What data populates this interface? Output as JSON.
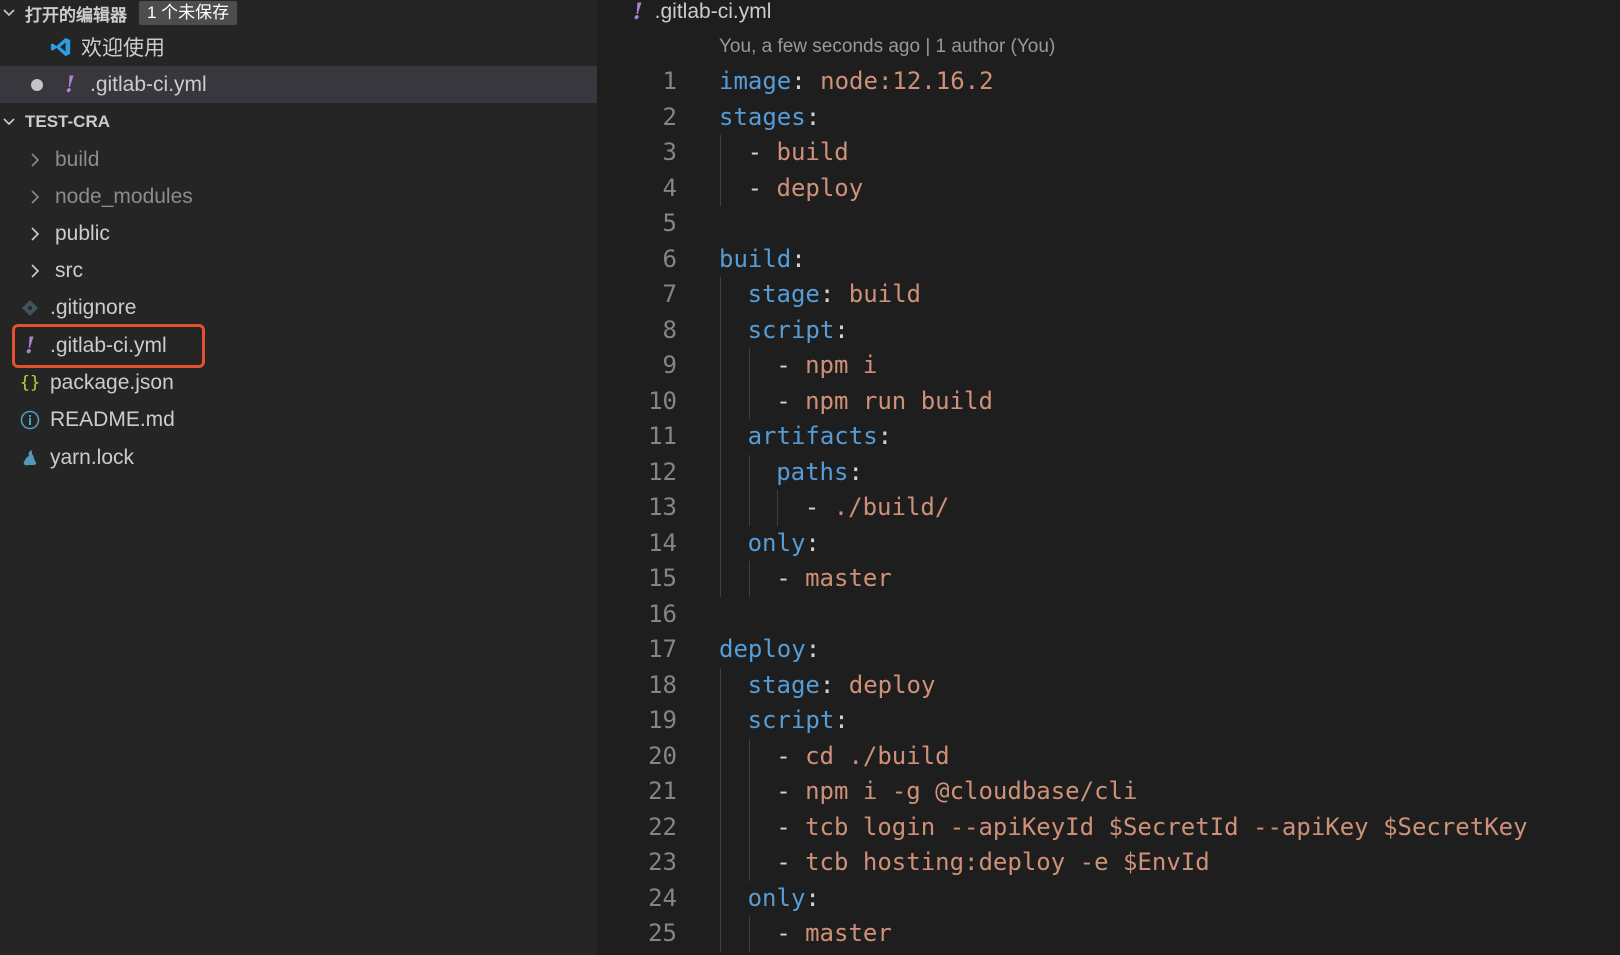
{
  "sidebar": {
    "open_editors": {
      "title": "打开的编辑器",
      "badge": "1 个未保存",
      "items": [
        {
          "label": "欢迎使用",
          "icon": "vscode-logo-icon"
        },
        {
          "label": ".gitlab-ci.yml",
          "icon": "yaml-file-icon",
          "unsaved": true
        }
      ]
    },
    "project": {
      "title": "TEST-CRA",
      "items": [
        {
          "label": "build",
          "type": "folder",
          "dim": true
        },
        {
          "label": "node_modules",
          "type": "folder",
          "dim": true
        },
        {
          "label": "public",
          "type": "folder"
        },
        {
          "label": "src",
          "type": "folder"
        },
        {
          "label": ".gitignore",
          "type": "file",
          "icon": "git-icon"
        },
        {
          "label": ".gitlab-ci.yml",
          "type": "file",
          "icon": "yaml-file-icon",
          "highlighted": true
        },
        {
          "label": "package.json",
          "type": "file",
          "icon": "json-icon"
        },
        {
          "label": "README.md",
          "type": "file",
          "icon": "info-icon"
        },
        {
          "label": "yarn.lock",
          "type": "file",
          "icon": "yarn-icon"
        }
      ]
    }
  },
  "editor": {
    "tab_title": ".gitlab-ci.yml",
    "blame": "You, a few seconds ago | 1 author (You)",
    "lines": [
      {
        "n": "1",
        "indent": 0,
        "tokens": [
          [
            "k",
            "image"
          ],
          [
            "p",
            ": "
          ],
          [
            "s",
            "node:12.16.2"
          ]
        ]
      },
      {
        "n": "2",
        "indent": 0,
        "tokens": [
          [
            "k",
            "stages"
          ],
          [
            "p",
            ":"
          ]
        ]
      },
      {
        "n": "3",
        "indent": 1,
        "tokens": [
          [
            "p",
            "- "
          ],
          [
            "s",
            "build"
          ]
        ]
      },
      {
        "n": "4",
        "indent": 1,
        "tokens": [
          [
            "p",
            "- "
          ],
          [
            "s",
            "deploy"
          ]
        ]
      },
      {
        "n": "5",
        "indent": 0,
        "tokens": []
      },
      {
        "n": "6",
        "indent": 0,
        "tokens": [
          [
            "k",
            "build"
          ],
          [
            "p",
            ":"
          ]
        ]
      },
      {
        "n": "7",
        "indent": 1,
        "tokens": [
          [
            "k",
            "stage"
          ],
          [
            "p",
            ": "
          ],
          [
            "s",
            "build"
          ]
        ]
      },
      {
        "n": "8",
        "indent": 1,
        "tokens": [
          [
            "k",
            "script"
          ],
          [
            "p",
            ":"
          ]
        ]
      },
      {
        "n": "9",
        "indent": 2,
        "tokens": [
          [
            "p",
            "- "
          ],
          [
            "s",
            "npm i"
          ]
        ]
      },
      {
        "n": "10",
        "indent": 2,
        "tokens": [
          [
            "p",
            "- "
          ],
          [
            "s",
            "npm run build"
          ]
        ]
      },
      {
        "n": "11",
        "indent": 1,
        "tokens": [
          [
            "k",
            "artifacts"
          ],
          [
            "p",
            ":"
          ]
        ]
      },
      {
        "n": "12",
        "indent": 2,
        "tokens": [
          [
            "k",
            "paths"
          ],
          [
            "p",
            ":"
          ]
        ]
      },
      {
        "n": "13",
        "indent": 3,
        "tokens": [
          [
            "p",
            "- "
          ],
          [
            "s",
            "./build/"
          ]
        ]
      },
      {
        "n": "14",
        "indent": 1,
        "tokens": [
          [
            "k",
            "only"
          ],
          [
            "p",
            ":"
          ]
        ]
      },
      {
        "n": "15",
        "indent": 2,
        "tokens": [
          [
            "p",
            "- "
          ],
          [
            "s",
            "master"
          ]
        ]
      },
      {
        "n": "16",
        "indent": 0,
        "tokens": []
      },
      {
        "n": "17",
        "indent": 0,
        "tokens": [
          [
            "k",
            "deploy"
          ],
          [
            "p",
            ":"
          ]
        ]
      },
      {
        "n": "18",
        "indent": 1,
        "tokens": [
          [
            "k",
            "stage"
          ],
          [
            "p",
            ": "
          ],
          [
            "s",
            "deploy"
          ]
        ]
      },
      {
        "n": "19",
        "indent": 1,
        "tokens": [
          [
            "k",
            "script"
          ],
          [
            "p",
            ":"
          ]
        ]
      },
      {
        "n": "20",
        "indent": 2,
        "tokens": [
          [
            "p",
            "- "
          ],
          [
            "s",
            "cd ./build"
          ]
        ]
      },
      {
        "n": "21",
        "indent": 2,
        "tokens": [
          [
            "p",
            "- "
          ],
          [
            "s",
            "npm i -g @cloudbase/cli"
          ]
        ]
      },
      {
        "n": "22",
        "indent": 2,
        "tokens": [
          [
            "p",
            "- "
          ],
          [
            "s",
            "tcb login --apiKeyId $SecretId --apiKey $SecretKey"
          ]
        ]
      },
      {
        "n": "23",
        "indent": 2,
        "tokens": [
          [
            "p",
            "- "
          ],
          [
            "s",
            "tcb hosting:deploy -e $EnvId"
          ]
        ]
      },
      {
        "n": "24",
        "indent": 1,
        "tokens": [
          [
            "k",
            "only"
          ],
          [
            "p",
            ":"
          ]
        ]
      },
      {
        "n": "25",
        "indent": 2,
        "tokens": [
          [
            "p",
            "- "
          ],
          [
            "s",
            "master"
          ]
        ]
      }
    ]
  },
  "colors": {
    "keyword": "#569cd6",
    "string": "#ce9178",
    "highlight_box": "#e2522f"
  }
}
